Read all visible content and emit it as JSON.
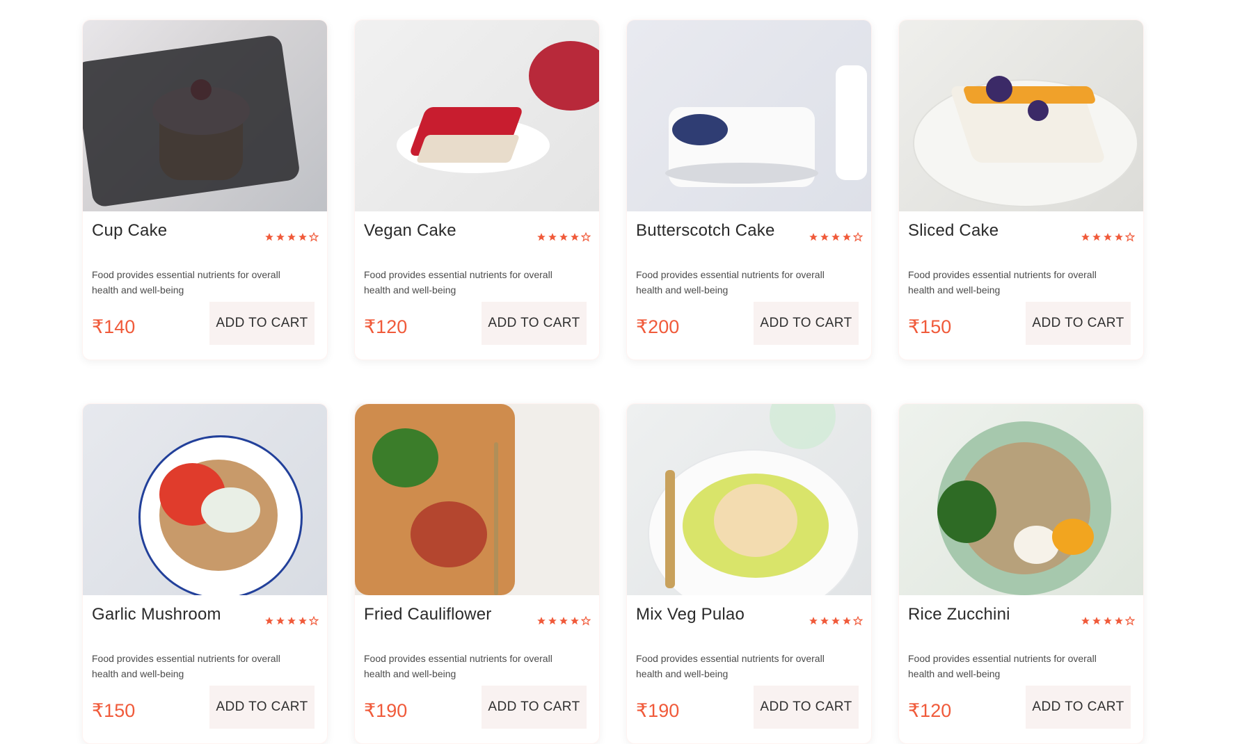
{
  "products": [
    {
      "name": "Cup Cake",
      "description": "Food provides essential nutrients for overall health and well-being",
      "price": "₹140",
      "rating": 4,
      "cart_label": "ADD TO CART",
      "image_icon": "cupcake-image"
    },
    {
      "name": "Vegan Cake",
      "description": "Food provides essential nutrients for overall health and well-being",
      "price": "₹120",
      "rating": 4,
      "cart_label": "ADD TO CART",
      "image_icon": "vegan-cake-image"
    },
    {
      "name": "Butterscotch Cake",
      "description": "Food provides essential nutrients for overall health and well-being",
      "price": "₹200",
      "rating": 4,
      "cart_label": "ADD TO CART",
      "image_icon": "butterscotch-cake-image"
    },
    {
      "name": "Sliced Cake",
      "description": "Food provides essential nutrients for overall health and well-being",
      "price": "₹150",
      "rating": 4,
      "cart_label": "ADD TO CART",
      "image_icon": "sliced-cake-image"
    },
    {
      "name": "Garlic Mushroom",
      "description": "Food provides essential nutrients for overall health and well-being",
      "price": "₹150",
      "rating": 4,
      "cart_label": "ADD TO CART",
      "image_icon": "garlic-mushroom-image"
    },
    {
      "name": "Fried Cauliflower",
      "description": "Food provides essential nutrients for overall health and well-being",
      "price": "₹190",
      "rating": 4,
      "cart_label": "ADD TO CART",
      "image_icon": "fried-cauliflower-image"
    },
    {
      "name": "Mix Veg Pulao",
      "description": "Food provides essential nutrients for overall health and well-being",
      "price": "₹190",
      "rating": 4,
      "cart_label": "ADD TO CART",
      "image_icon": "mix-veg-pulao-image"
    },
    {
      "name": "Rice Zucchini",
      "description": "Food provides essential nutrients for overall health and well-being",
      "price": "₹120",
      "rating": 4,
      "cart_label": "ADD TO CART",
      "image_icon": "rice-zucchini-image"
    }
  ],
  "colors": {
    "accent": "#f05a3a",
    "button_bg": "#f9f2f1",
    "title_text": "#2a2a2a"
  }
}
